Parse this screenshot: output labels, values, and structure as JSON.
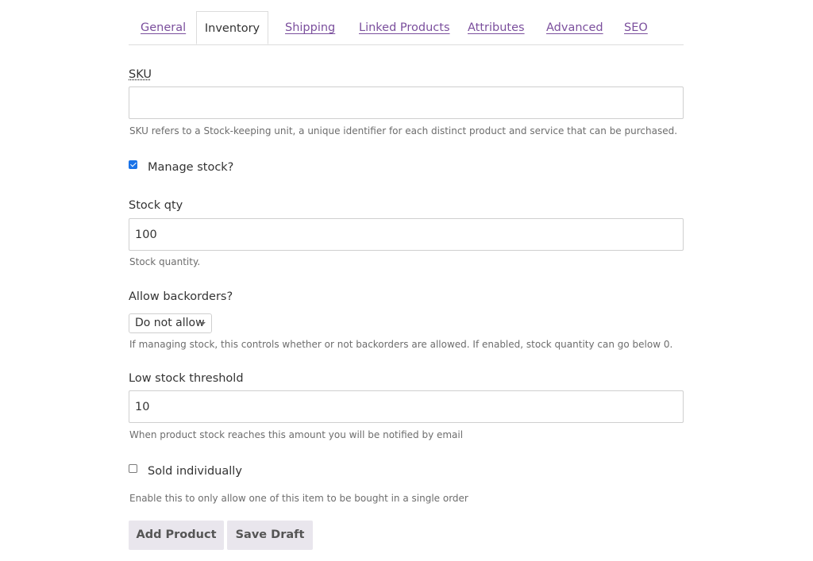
{
  "tabs": [
    {
      "label": "General",
      "active": false
    },
    {
      "label": "Inventory",
      "active": true
    },
    {
      "label": "Shipping",
      "active": false
    },
    {
      "label": "Linked Products",
      "active": false
    },
    {
      "label": "Attributes",
      "active": false
    },
    {
      "label": "Advanced",
      "active": false
    },
    {
      "label": "SEO",
      "active": false
    }
  ],
  "sku": {
    "label": "SKU",
    "value": "",
    "help": "SKU refers to a Stock-keeping unit, a unique identifier for each distinct product and service that can be purchased."
  },
  "manage_stock": {
    "label": "Manage stock?",
    "checked": true
  },
  "stock_qty": {
    "label": "Stock qty",
    "value": "100",
    "help": "Stock quantity."
  },
  "backorders": {
    "label": "Allow backorders?",
    "selected": "Do not allow",
    "help": "If managing stock, this controls whether or not backorders are allowed. If enabled, stock quantity can go below 0."
  },
  "low_stock": {
    "label": "Low stock threshold",
    "value": "10",
    "help": "When product stock reaches this amount you will be notified by email"
  },
  "sold_individually": {
    "label": "Sold individually",
    "checked": false,
    "help": "Enable this to only allow one of this item to be bought in a single order"
  },
  "actions": {
    "add_label": "Add Product",
    "draft_label": "Save Draft"
  },
  "colors": {
    "link": "#7b4f9d",
    "button_bg": "#e9e6ed",
    "checkbox_checked": "#1a73e8"
  }
}
